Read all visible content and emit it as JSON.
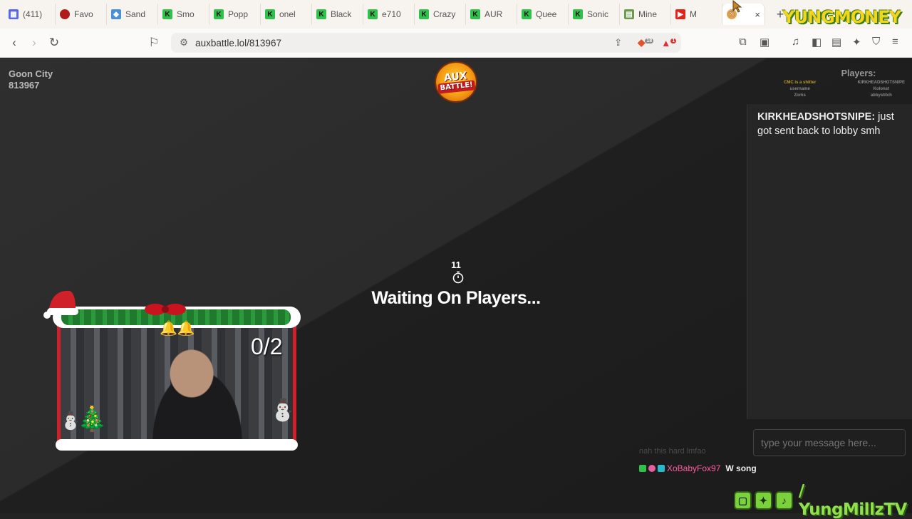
{
  "browser": {
    "tabs": [
      {
        "label": "(411)",
        "icon": "discord-icon"
      },
      {
        "label": "Favo",
        "icon": "record-icon"
      },
      {
        "label": "Sand",
        "icon": "cube-icon"
      },
      {
        "label": "Smo",
        "icon": "kick-icon"
      },
      {
        "label": "Popp",
        "icon": "kick-icon"
      },
      {
        "label": "onel",
        "icon": "kick-icon"
      },
      {
        "label": "Black",
        "icon": "kick-icon"
      },
      {
        "label": "e710",
        "icon": "kick-icon"
      },
      {
        "label": "Crazy",
        "icon": "kick-icon"
      },
      {
        "label": "AUR",
        "icon": "kick-icon"
      },
      {
        "label": "Quee",
        "icon": "kick-icon"
      },
      {
        "label": "Sonic",
        "icon": "kick-icon"
      },
      {
        "label": "Mine",
        "icon": "docs-icon"
      },
      {
        "label": "M",
        "icon": "youtube-icon"
      }
    ],
    "active_tab_close": "×",
    "new_tab": "+",
    "url": "auxbattle.lol/813967",
    "brave_badge": "18",
    "alert_badge": "1"
  },
  "overlay": {
    "yungmoney": "YUNGMONEY",
    "social_handle": "/ YungMillzTV"
  },
  "game": {
    "room_name": "Goon City",
    "room_code": "813967",
    "logo_line1": "AUX",
    "logo_line2": "BATTLE!",
    "players_title": "Players:",
    "players_left": [
      "CMC is a shitter",
      "username",
      "Zorks"
    ],
    "players_right": [
      "KIRKHEADSHOTSNIPE",
      "Kolonst",
      "abbystitch"
    ],
    "timer": "11",
    "status": "Waiting On Players..."
  },
  "chat": {
    "message_user": "KIRKHEADSHOTSNIPE:",
    "message_text": " just got sent back to lobby smh",
    "input_placeholder": "type your message here..."
  },
  "webcam": {
    "counter": "0/2"
  },
  "stream_chat": {
    "ghost_text": "nah this hard lmfao",
    "user": "XoBabyFox97",
    "message": "W song"
  },
  "colors": {
    "accent_green": "#8fe04a",
    "kick_green": "#2ec24d",
    "frame_red": "#d0202a"
  }
}
